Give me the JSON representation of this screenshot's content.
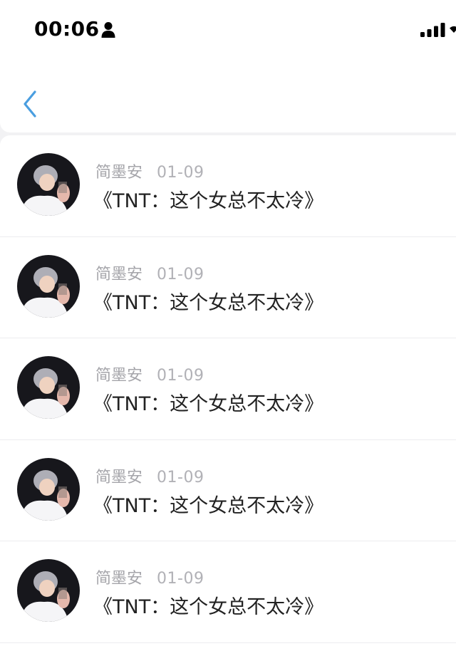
{
  "status_bar": {
    "time": "00:06"
  },
  "nav": {
    "back_icon": "chevron-left-icon",
    "accent_color": "#4a9ee0"
  },
  "comments": [
    {
      "name": "简墨安",
      "date": "01-09",
      "text": "《TNT：这个女总不太冷》"
    },
    {
      "name": "简墨安",
      "date": "01-09",
      "text": "《TNT：这个女总不太冷》"
    },
    {
      "name": "简墨安",
      "date": "01-09",
      "text": "《TNT：这个女总不太冷》"
    },
    {
      "name": "简墨安",
      "date": "01-09",
      "text": "《TNT：这个女总不太冷》"
    },
    {
      "name": "简墨安",
      "date": "01-09",
      "text": "《TNT：这个女总不太冷》"
    }
  ]
}
